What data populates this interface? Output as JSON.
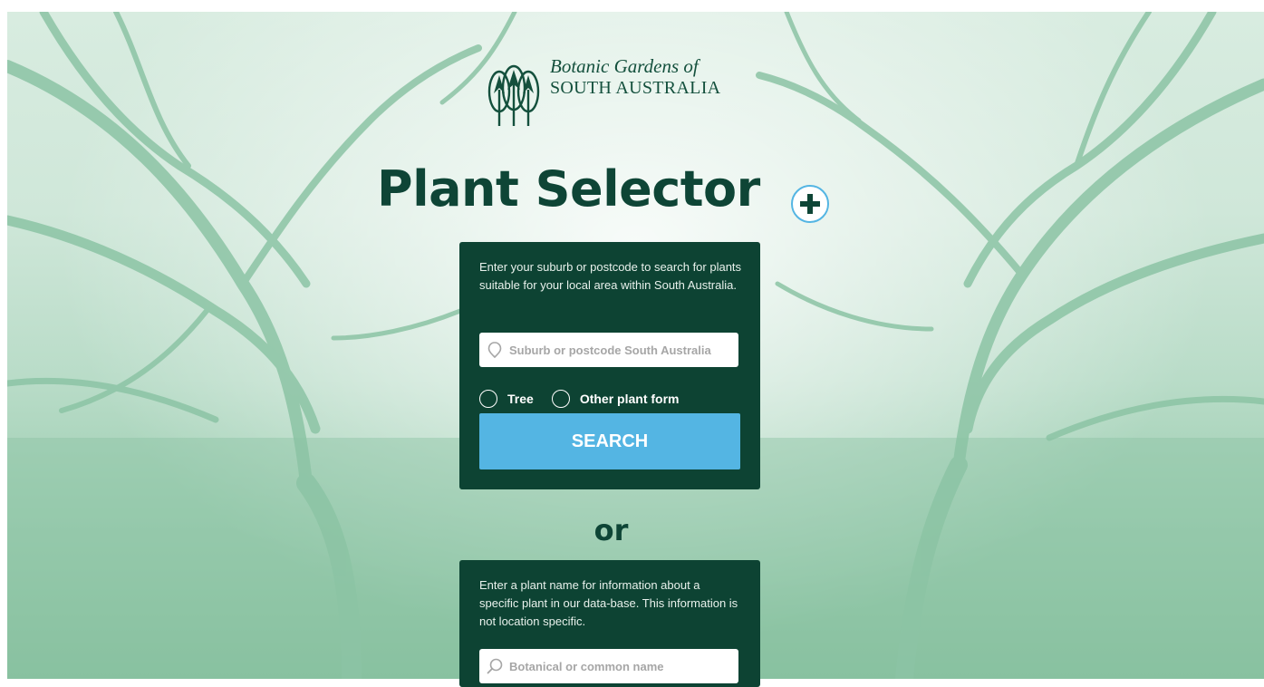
{
  "logo": {
    "line1": "Botanic Gardens of",
    "line2": "SOUTH AUSTRALIA"
  },
  "title": "Plant Selector",
  "colors": {
    "panel": "#0d4333",
    "accent_button": "#54b5e3",
    "title": "#0e4536"
  },
  "location_panel": {
    "description": "Enter your suburb or postcode to search for plants suitable for your local area within South Australia.",
    "input_placeholder": "Suburb or postcode South Australia",
    "input_value": "",
    "input_icon": "location-pin-icon",
    "radios": [
      {
        "label": "Tree",
        "checked": false
      },
      {
        "label": "Other plant form",
        "checked": false
      }
    ],
    "search_label": "SEARCH"
  },
  "separator": "or",
  "name_panel": {
    "description": "Enter a plant name for information about a specific plant in our data-base. This information is not location specific.",
    "input_placeholder": "Botanical or common name",
    "input_value": "",
    "input_icon": "search-icon"
  }
}
